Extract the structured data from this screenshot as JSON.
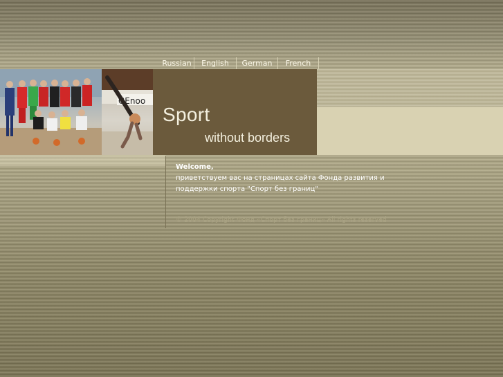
{
  "languages": [
    "Russian",
    "English",
    "German",
    "French"
  ],
  "header": {
    "title": "Sport",
    "subtitle": "without borders"
  },
  "content": {
    "welcome": "Welcome,",
    "lines": [
      "приветствуем вас на страницах сайта Фонда развития и",
      "поддержки спорта \"Спорт без границ\""
    ]
  },
  "footer": {
    "text": "© 2004 Copyright Фонд «Спорт без границ» All rights reserved"
  },
  "colors": {
    "title_box": "#6b5a3c",
    "text": "#f4f0df",
    "background": "#8e8560"
  }
}
